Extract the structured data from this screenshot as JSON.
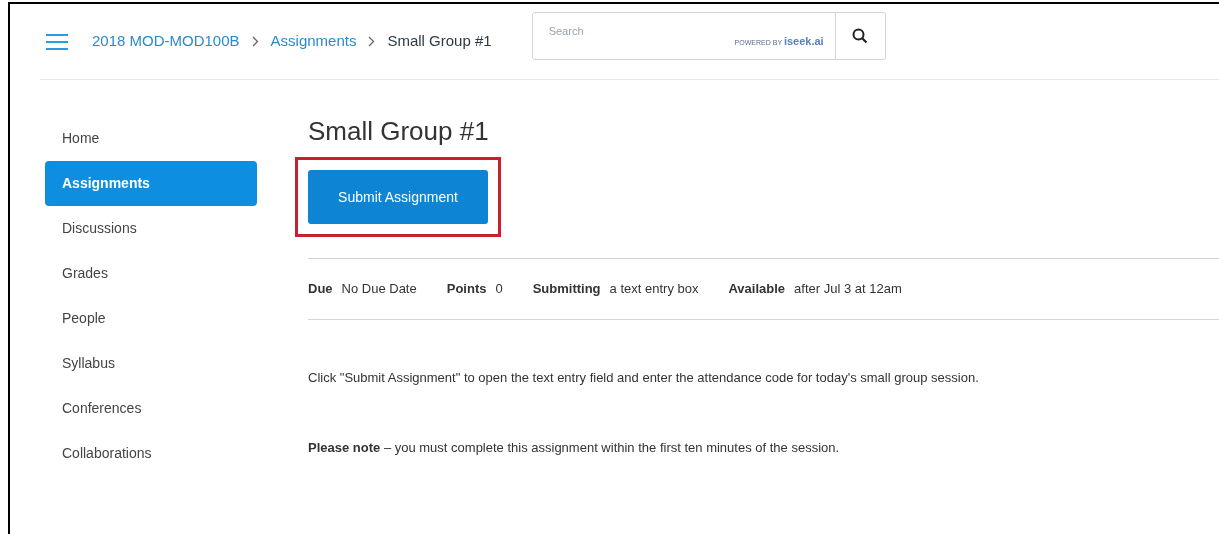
{
  "breadcrumbs": [
    {
      "label": "2018 MOD-MOD100B",
      "link": true
    },
    {
      "label": "Assignments",
      "link": true
    },
    {
      "label": "Small Group #1",
      "link": false
    }
  ],
  "search": {
    "placeholder": "Search",
    "powered_by": "POWERED BY",
    "brand": "iseek.ai"
  },
  "sidebar": {
    "items": [
      {
        "label": "Home",
        "selected": false
      },
      {
        "label": "Assignments",
        "selected": true
      },
      {
        "label": "Discussions",
        "selected": false
      },
      {
        "label": "Grades",
        "selected": false
      },
      {
        "label": "People",
        "selected": false
      },
      {
        "label": "Syllabus",
        "selected": false
      },
      {
        "label": "Conferences",
        "selected": false
      },
      {
        "label": "Collaborations",
        "selected": false
      }
    ]
  },
  "title": "Small Group #1",
  "submit_button": {
    "label": "Submit Assignment",
    "highlighted": true
  },
  "details": [
    {
      "label": "Due",
      "value": "No Due Date"
    },
    {
      "label": "Points",
      "value": "0"
    },
    {
      "label": "Submitting",
      "value": "a text entry box"
    },
    {
      "label": "Available",
      "value": "after Jul 3 at 12am"
    }
  ],
  "paragraphs": [
    "Click \"Submit Assignment\" to open the text entry field and enter the attendance code for today's small group session.",
    "**Please note** – you must complete this assignment within the first ten minutes of the session."
  ]
}
